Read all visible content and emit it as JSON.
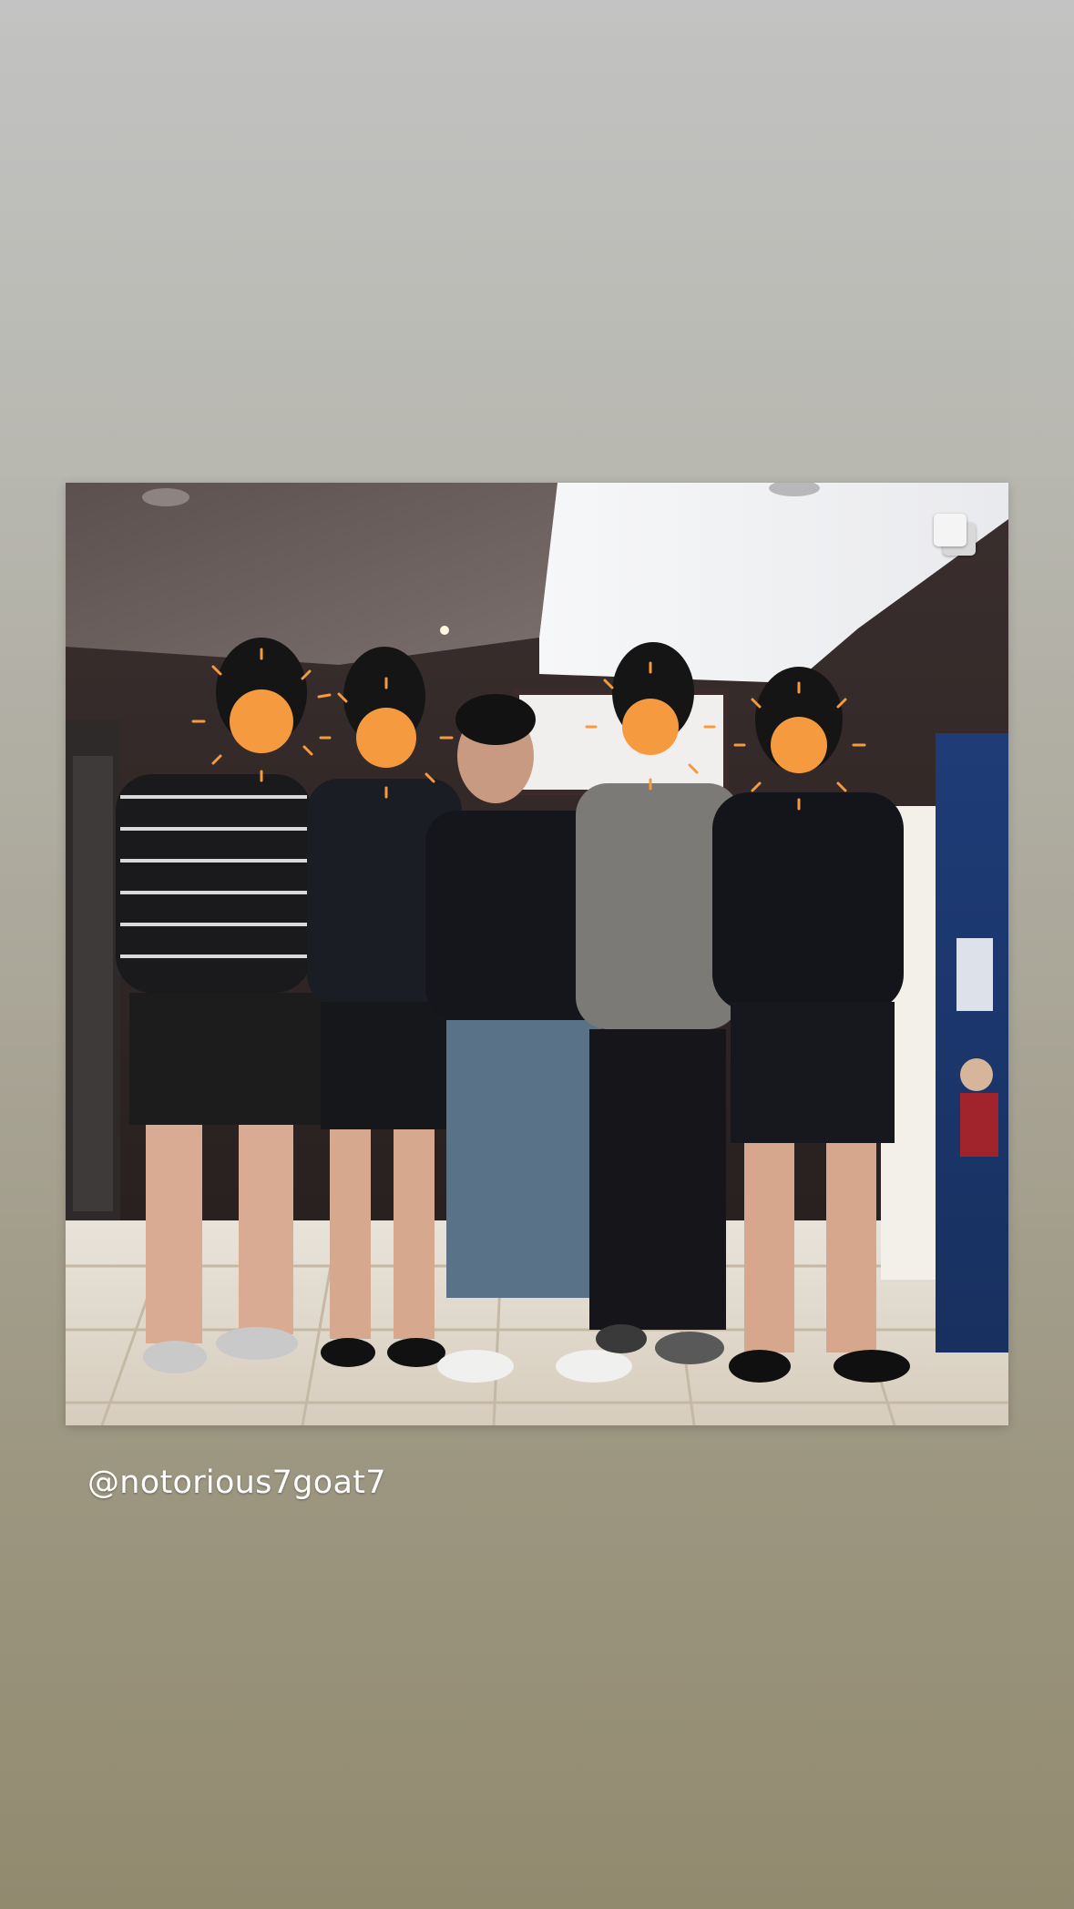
{
  "story": {
    "background_colors": [
      "#c2c3c2",
      "#aaa698",
      "#928a6f"
    ],
    "post": {
      "multi_image_indicator_icon": "carousel-icon",
      "face_cover_color": "#f59a3e",
      "people_count": 5
    },
    "mention": "@notorious7goat7"
  }
}
